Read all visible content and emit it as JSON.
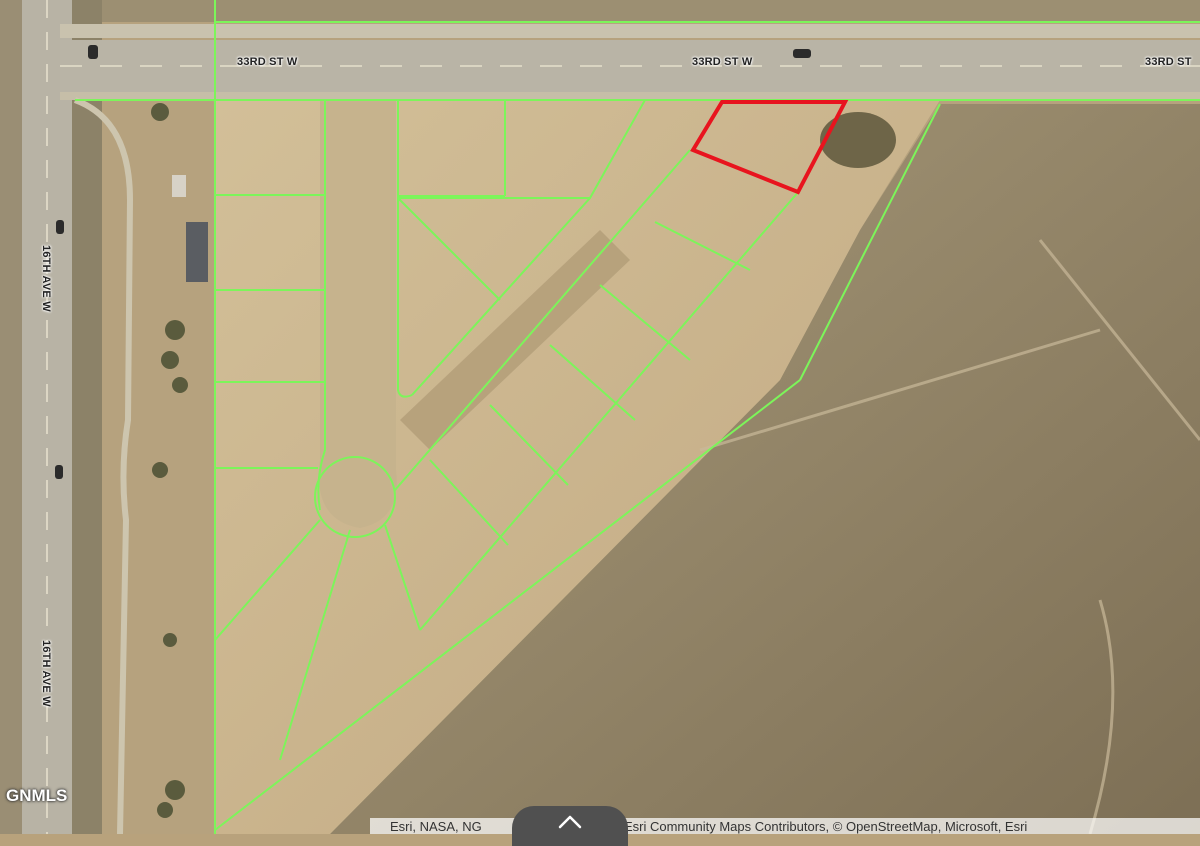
{
  "map": {
    "roads": {
      "horizontal": [
        {
          "label": "33RD ST W"
        },
        {
          "label": "33RD ST W"
        },
        {
          "label": "33RD ST"
        }
      ],
      "vertical": [
        {
          "label": "16TH AVE W"
        },
        {
          "label": "16TH AVE W"
        }
      ]
    },
    "colors": {
      "parcel_lines": "#7cf55a",
      "selected_parcel": "#e8141e",
      "road": "#b9b4a6",
      "terrain_light": "#c8b48e",
      "terrain_dark": "#8a7a5c"
    },
    "watermark": "GNMLS",
    "attribution": "Esri, NASA, NG",
    "attribution_more": "| Esri Community Maps Contributors, © OpenStreetMap, Microsoft, Esri",
    "expand_control": {
      "icon": "chevron-up-icon"
    }
  }
}
